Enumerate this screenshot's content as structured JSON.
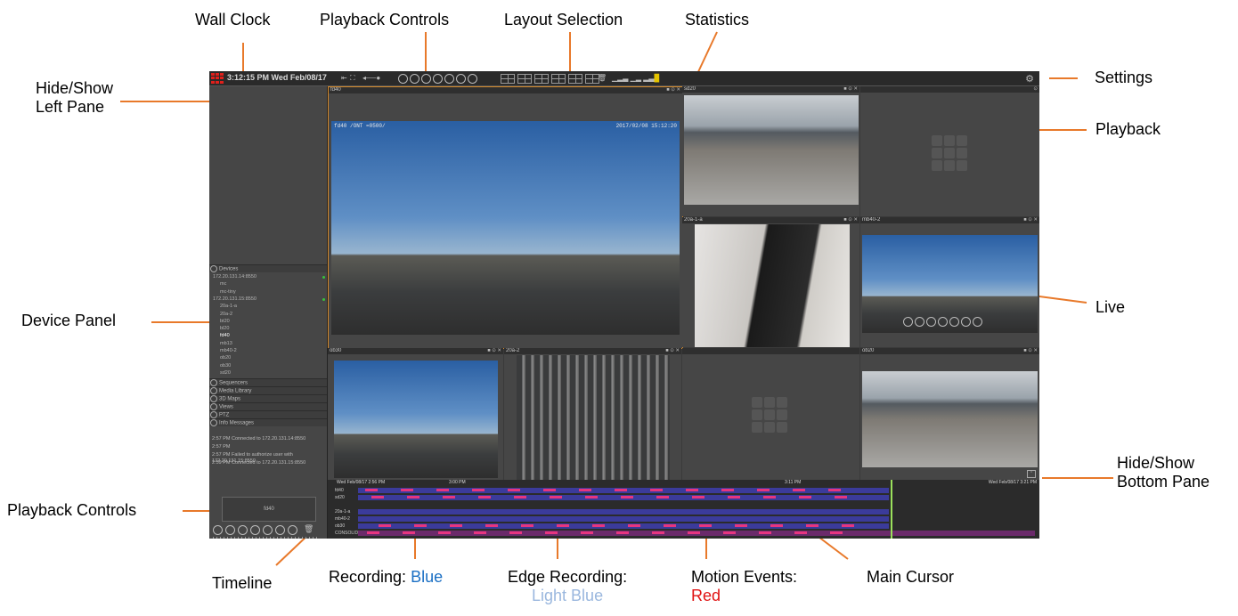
{
  "callouts": {
    "wall_clock": "Wall Clock",
    "playback_controls_top": "Playback Controls",
    "layout_selection": "Layout Selection",
    "statistics": "Statistics",
    "hide_show_left_1": "Hide/Show",
    "hide_show_left_2": "Left Pane",
    "settings": "Settings",
    "playback": "Playback",
    "device_panel": "Device Panel",
    "live": "Live",
    "hide_show_bottom_1": "Hide/Show",
    "hide_show_bottom_2": "Bottom Pane",
    "playback_controls_bottom": "Playback Controls",
    "timeline": "Timeline",
    "recording_label": "Recording:",
    "recording_color": "Blue",
    "edge_recording_label": "Edge Recording:",
    "edge_recording_color": "Light Blue",
    "motion_label": "Motion Events:",
    "motion_color": "Red",
    "main_cursor": "Main Cursor"
  },
  "app": {
    "clock": "3:12:15 PM Wed Feb/08/17",
    "left_pane": {
      "devices_header": "Devices",
      "device_tree": [
        {
          "label": "172.20.131.14:8550",
          "indent": 0,
          "online": true
        },
        {
          "label": "mc",
          "indent": 1
        },
        {
          "label": "mc-tiny",
          "indent": 1
        },
        {
          "label": "172.20.131.15:8550",
          "indent": 0,
          "online": true
        },
        {
          "label": "20a-1-a",
          "indent": 1
        },
        {
          "label": "20a-2",
          "indent": 1
        },
        {
          "label": "bt20",
          "indent": 1
        },
        {
          "label": "bl20",
          "indent": 1
        },
        {
          "label": "fd40",
          "indent": 1,
          "selected": true
        },
        {
          "label": "mb13",
          "indent": 1
        },
        {
          "label": "mb40-2",
          "indent": 1
        },
        {
          "label": "ob20",
          "indent": 1
        },
        {
          "label": "ob30",
          "indent": 1
        },
        {
          "label": "sd20",
          "indent": 1
        }
      ],
      "sections": [
        "Sequencers",
        "Media Library",
        "3D Maps",
        "Views",
        "PTZ",
        "Info Messages"
      ],
      "messages": [
        "2:57 PM  Connected to 172.20.131.14:8550",
        "2:57 PM",
        "2:57 PM  Failed to authorize user with 172.20.131.15:8550",
        "2:59 PM  Connected to 172.20.131.15:8550"
      ],
      "thumbnail_label": "fd40"
    },
    "tiles": {
      "fd40": {
        "title": "fd40",
        "overlay_left": "fd40 /ONT =0500/",
        "overlay_right": "2017/02/08 15:12:20"
      },
      "sd20": {
        "title": "sd20"
      },
      "empty_top": {
        "title": ""
      },
      "cam_20a1a": {
        "title": "20a-1-a"
      },
      "mb40_2": {
        "title": "mb40-2"
      },
      "ob30": {
        "title": "ob30"
      },
      "cam_20a2": {
        "title": "20a-2"
      },
      "empty_bottom": {
        "title": ""
      },
      "ob20": {
        "title": "ob20"
      }
    },
    "timeline": {
      "start_label": "Wed Feb/08/17 2:56 PM",
      "mid_label_1": "3:00 PM",
      "mid_label_2": "3:11 PM",
      "end_label": "Wed Feb/08/17 3:21 PM",
      "rows": [
        "fd40",
        "sd20",
        "",
        "20a-1-a",
        "mb40-2",
        "ob30",
        "CONSOLIDATED"
      ]
    }
  },
  "colors": {
    "recording": "#1a6fc4",
    "edge_recording": "#9ab7de",
    "motion": "#e01313",
    "callout_line": "#e8792a"
  }
}
